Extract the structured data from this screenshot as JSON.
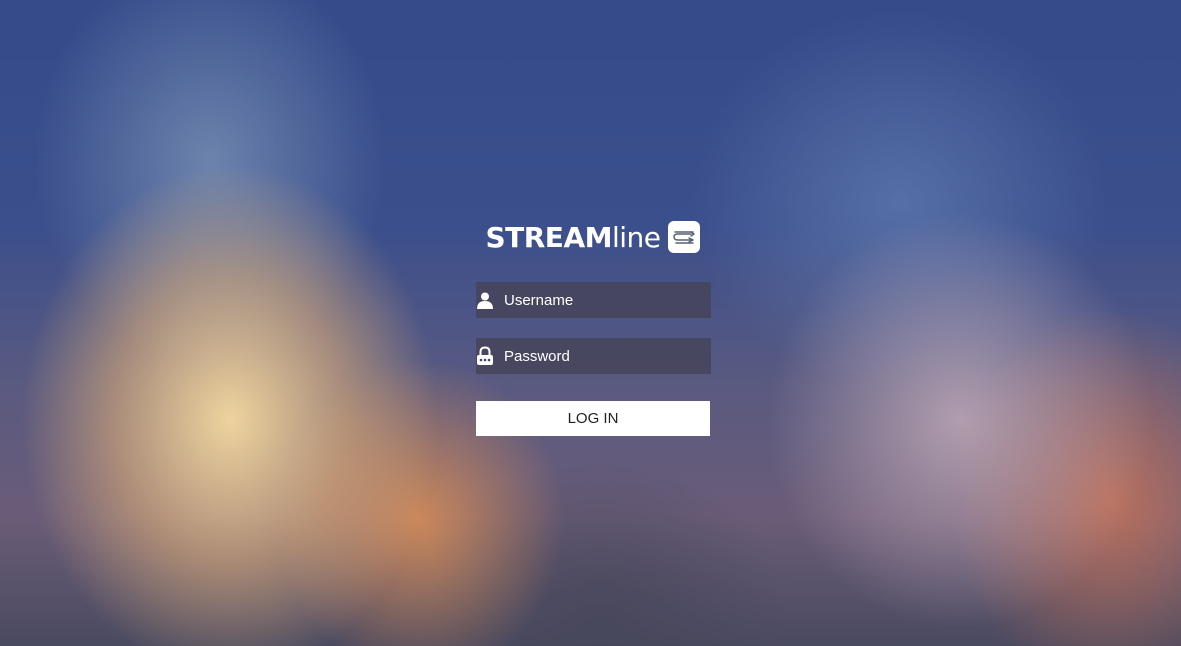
{
  "brand": {
    "name_bold": "STREAM",
    "name_light": "line",
    "logo_icon": "streamline-logo-icon"
  },
  "form": {
    "username": {
      "placeholder": "Username",
      "value": "",
      "icon": "user-icon"
    },
    "password": {
      "placeholder": "Password",
      "value": "",
      "icon": "lock-icon"
    },
    "login_label": "LOG IN"
  },
  "colors": {
    "field_background": "#46445a",
    "button_background": "#ffffff",
    "text_light": "#ffffff",
    "button_text": "#222222"
  }
}
